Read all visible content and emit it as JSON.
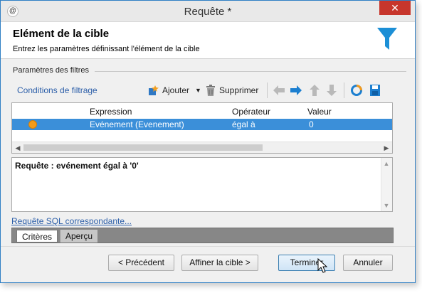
{
  "window": {
    "title": "Requête *",
    "app_icon": "app-icon",
    "close_label": "✕"
  },
  "header": {
    "title": "Elément de la cible",
    "subtitle": "Entrez les paramètres définissant l'élément de la cible",
    "icon": "funnel-icon"
  },
  "filters_section": {
    "label": "Paramètres des filtres"
  },
  "toolbar": {
    "conditions_link": "Conditions de filtrage",
    "add_label": "Ajouter",
    "delete_label": "Supprimer"
  },
  "grid": {
    "columns": [
      "Expression",
      "Opérateur",
      "Valeur"
    ],
    "rows": [
      {
        "expression": "Evénement (Evenement)",
        "operator": "égal à",
        "value": "0"
      }
    ]
  },
  "query": {
    "text": "Requête : evénement égal à '0'"
  },
  "sql_link": "Requête SQL correspondante...",
  "tabs": [
    {
      "label": "Critères",
      "active": true
    },
    {
      "label": "Aperçu",
      "active": false
    }
  ],
  "buttons": {
    "previous": "< Précédent",
    "refine": "Affiner la cible >",
    "finish": "Terminer",
    "cancel": "Annuler"
  },
  "colors": {
    "accent": "#2a5da8",
    "selection": "#3b8fd9",
    "close": "#c7362c"
  }
}
